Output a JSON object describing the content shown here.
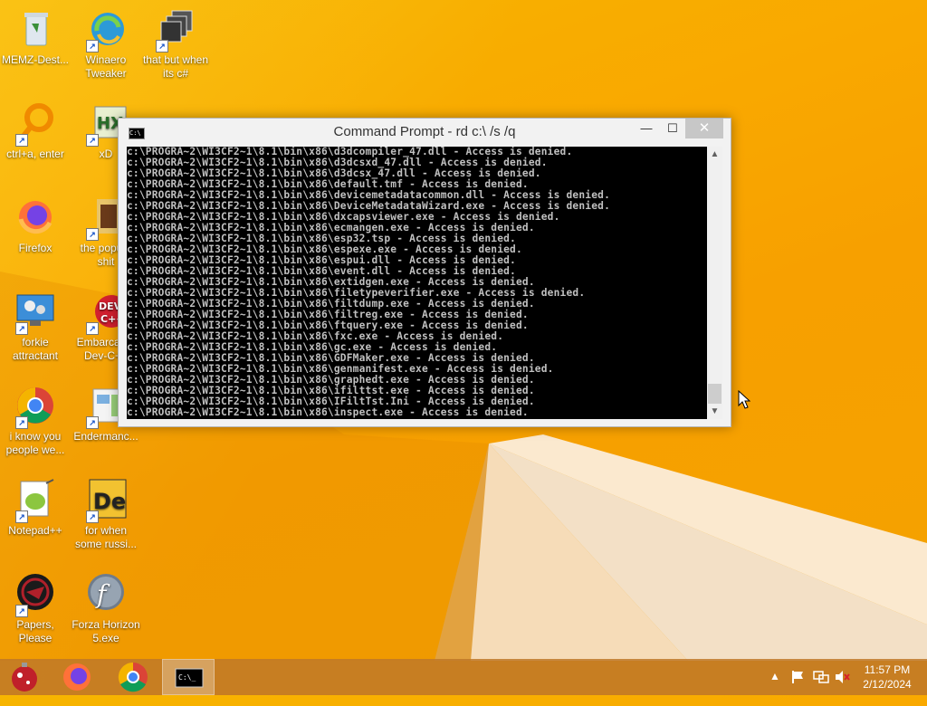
{
  "desktop": {
    "icons": [
      {
        "label": "MEMZ-Dest..."
      },
      {
        "label": "Winaero Tweaker"
      },
      {
        "label": "that but when its c#"
      },
      {
        "label": "ctrl+a, enter"
      },
      {
        "label": "xD"
      },
      {
        "label": "Firefox"
      },
      {
        "label": "the popu... shit"
      },
      {
        "label": "forkie attractant"
      },
      {
        "label": "Embarcad... Dev-C++"
      },
      {
        "label": "i know you people we..."
      },
      {
        "label": "Endermanc..."
      },
      {
        "label": "Notepad++"
      },
      {
        "label": "for when some russi..."
      },
      {
        "label": "Papers, Please"
      },
      {
        "label": "Forza Horizon 5.exe"
      }
    ]
  },
  "cmd": {
    "title": "Command Prompt - rd  c:\\ /s /q",
    "icon_text": "C:\\",
    "buttons": {
      "minimize": "—",
      "maximize": "☐",
      "close": "✕"
    },
    "lines": [
      "c:\\PROGRA~2\\WI3CF2~1\\8.1\\bin\\x86\\d3dcompiler_47.dll - Access is denied.",
      "c:\\PROGRA~2\\WI3CF2~1\\8.1\\bin\\x86\\d3dcsxd_47.dll - Access is denied.",
      "c:\\PROGRA~2\\WI3CF2~1\\8.1\\bin\\x86\\d3dcsx_47.dll - Access is denied.",
      "c:\\PROGRA~2\\WI3CF2~1\\8.1\\bin\\x86\\default.tmf - Access is denied.",
      "c:\\PROGRA~2\\WI3CF2~1\\8.1\\bin\\x86\\devicemetadatacommon.dll - Access is denied.",
      "c:\\PROGRA~2\\WI3CF2~1\\8.1\\bin\\x86\\DeviceMetadataWizard.exe - Access is denied.",
      "c:\\PROGRA~2\\WI3CF2~1\\8.1\\bin\\x86\\dxcapsviewer.exe - Access is denied.",
      "c:\\PROGRA~2\\WI3CF2~1\\8.1\\bin\\x86\\ecmangen.exe - Access is denied.",
      "c:\\PROGRA~2\\WI3CF2~1\\8.1\\bin\\x86\\esp32.tsp - Access is denied.",
      "c:\\PROGRA~2\\WI3CF2~1\\8.1\\bin\\x86\\espexe.exe - Access is denied.",
      "c:\\PROGRA~2\\WI3CF2~1\\8.1\\bin\\x86\\espui.dll - Access is denied.",
      "c:\\PROGRA~2\\WI3CF2~1\\8.1\\bin\\x86\\event.dll - Access is denied.",
      "c:\\PROGRA~2\\WI3CF2~1\\8.1\\bin\\x86\\extidgen.exe - Access is denied.",
      "c:\\PROGRA~2\\WI3CF2~1\\8.1\\bin\\x86\\filetypeverifier.exe - Access is denied.",
      "c:\\PROGRA~2\\WI3CF2~1\\8.1\\bin\\x86\\filtdump.exe - Access is denied.",
      "c:\\PROGRA~2\\WI3CF2~1\\8.1\\bin\\x86\\filtreg.exe - Access is denied.",
      "c:\\PROGRA~2\\WI3CF2~1\\8.1\\bin\\x86\\ftquery.exe - Access is denied.",
      "c:\\PROGRA~2\\WI3CF2~1\\8.1\\bin\\x86\\fxc.exe - Access is denied.",
      "c:\\PROGRA~2\\WI3CF2~1\\8.1\\bin\\x86\\gc.exe - Access is denied.",
      "c:\\PROGRA~2\\WI3CF2~1\\8.1\\bin\\x86\\GDFMaker.exe - Access is denied.",
      "c:\\PROGRA~2\\WI3CF2~1\\8.1\\bin\\x86\\genmanifest.exe - Access is denied.",
      "c:\\PROGRA~2\\WI3CF2~1\\8.1\\bin\\x86\\graphedt.exe - Access is denied.",
      "c:\\PROGRA~2\\WI3CF2~1\\8.1\\bin\\x86\\ifilttst.exe - Access is denied.",
      "c:\\PROGRA~2\\WI3CF2~1\\8.1\\bin\\x86\\IFiltTst.Ini - Access is denied.",
      "c:\\PROGRA~2\\WI3CF2~1\\8.1\\bin\\x86\\inspect.exe - Access is denied."
    ]
  },
  "taskbar": {
    "items": [
      {
        "icon": "memz-ornament-icon"
      },
      {
        "icon": "firefox-icon"
      },
      {
        "icon": "chrome-icon"
      },
      {
        "icon": "command-prompt-icon",
        "active": true
      }
    ],
    "tray": {
      "show_hidden": "▲",
      "time": "11:57 PM",
      "date": "2/12/2024"
    }
  },
  "colors": {
    "wallpaper": "#f7a800",
    "console_bg": "#000000",
    "console_text": "#c0c0c0"
  }
}
